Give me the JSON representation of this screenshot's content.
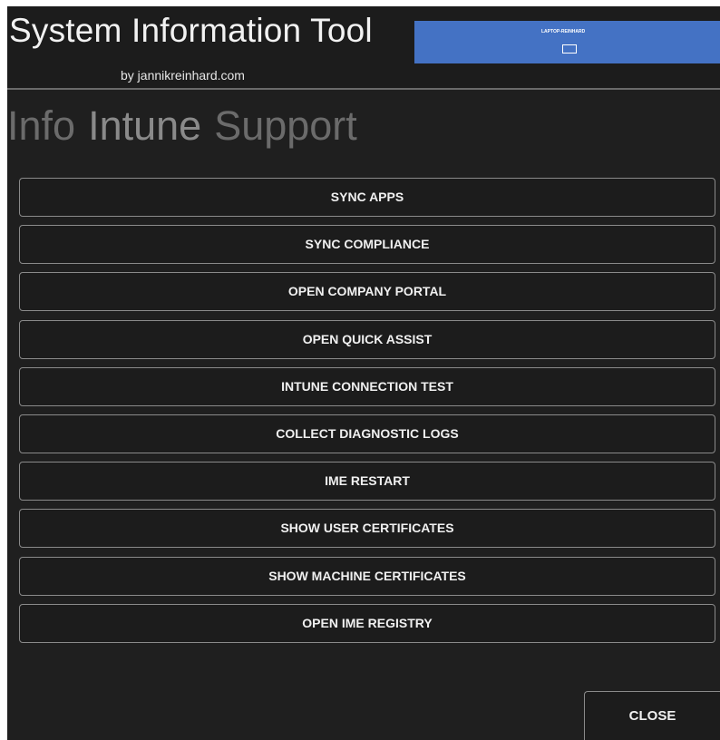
{
  "header": {
    "title": "System Information Tool",
    "subtitle": "by jannikreinhard.com",
    "device_tile": {
      "name": "LAPTOP-REINHARD",
      "icon": "monitor-icon",
      "color": "#4472c4"
    }
  },
  "tabs": [
    {
      "label": "Info",
      "active": false
    },
    {
      "label": "Intune",
      "active": true
    },
    {
      "label": "Support",
      "active": false
    }
  ],
  "actions": [
    {
      "label": "SYNC APPS"
    },
    {
      "label": "SYNC COMPLIANCE"
    },
    {
      "label": "OPEN COMPANY PORTAL"
    },
    {
      "label": "OPEN QUICK ASSIST"
    },
    {
      "label": "INTUNE CONNECTION TEST"
    },
    {
      "label": "COLLECT DIAGNOSTIC LOGS"
    },
    {
      "label": "IME RESTART"
    },
    {
      "label": "SHOW USER CERTIFICATES"
    },
    {
      "label": "SHOW MACHINE CERTIFICATES"
    },
    {
      "label": "OPEN IME REGISTRY"
    }
  ],
  "footer": {
    "close_label": "CLOSE"
  },
  "colors": {
    "background": "#1f1f1f",
    "button_border": "#8a8a8a",
    "tab_text": "#6b6b6b",
    "accent": "#4472c4"
  }
}
